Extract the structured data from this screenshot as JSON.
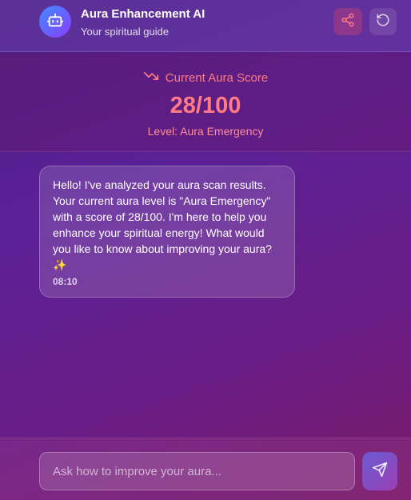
{
  "header": {
    "title": "Aura Enhancement AI",
    "subtitle": "Your spiritual guide",
    "avatar_icon": "robot-icon",
    "share_icon": "share-icon",
    "reset_icon": "refresh-icon"
  },
  "score": {
    "label": "Current Aura Score",
    "trend_icon": "trending-down-icon",
    "value": "28/100",
    "level": "Level: Aura Emergency",
    "color": "#ff7b86"
  },
  "messages": [
    {
      "role": "assistant",
      "text": "Hello! I've analyzed your aura scan results. Your current aura level is \"Aura Emergency\" with a score of 28/100. I'm here to help you enhance your spiritual energy! What would you like to know about improving your aura? ✨",
      "time": "08:10"
    }
  ],
  "composer": {
    "placeholder": "Ask how to improve your aura...",
    "value": "",
    "send_icon": "send-icon"
  }
}
